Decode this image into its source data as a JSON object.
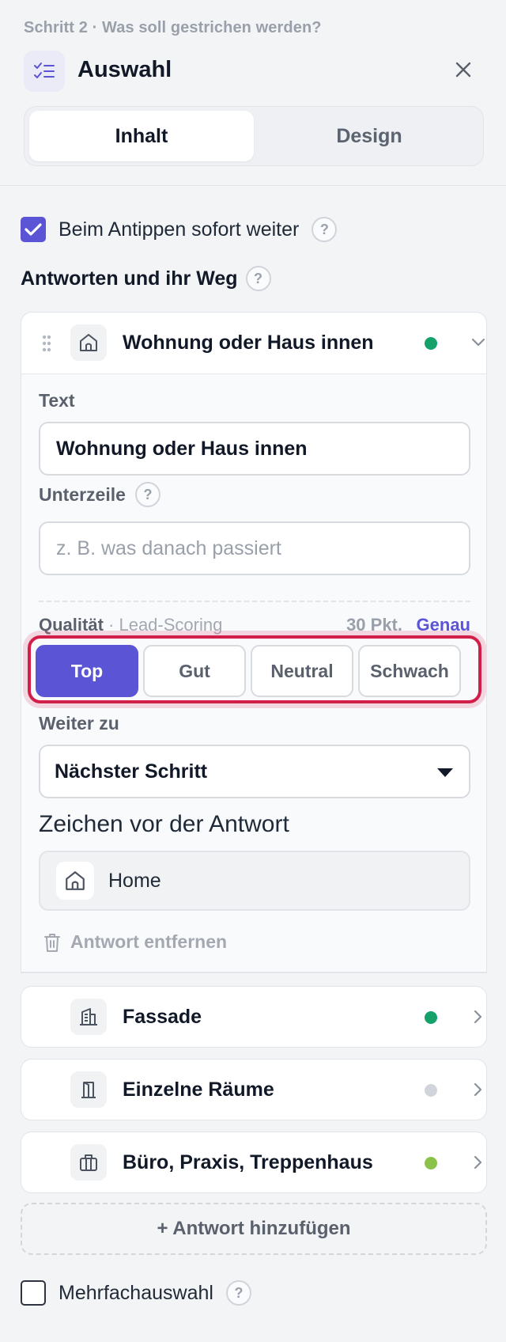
{
  "header": {
    "step": "Schritt 2 · Was soll gestrichen werden?",
    "title": "Auswahl",
    "tabs": [
      {
        "label": "Inhalt",
        "active": true
      },
      {
        "label": "Design",
        "active": false
      }
    ]
  },
  "options": {
    "auto_advance": {
      "label": "Beim Antippen sofort weiter",
      "checked": true
    },
    "answers_heading": "Antworten und ihr Weg",
    "multi_select": {
      "label": "Mehrfachauswahl",
      "checked": false
    }
  },
  "help_glyph": "?",
  "expanded_answer": {
    "title": "Wohnung oder Haus innen",
    "status_color": "#16a06a",
    "text_label": "Text",
    "text_value": "Wohnung oder Haus innen",
    "subline_label": "Unterzeile",
    "subline_placeholder": "z. B. was danach passiert",
    "quality_label": "Qualität",
    "quality_sub": "· Lead-Scoring",
    "quality_points": "30 Pkt.",
    "quality_link": "Genau",
    "quality_options": [
      "Top",
      "Gut",
      "Neutral",
      "Schwach"
    ],
    "quality_selected": "Top",
    "next_label": "Weiter zu",
    "next_value": "Nächster Schritt",
    "icon_label": "Zeichen vor der Antwort",
    "icon_value": "Home",
    "remove_label": "Antwort entfernen"
  },
  "answers": [
    {
      "title": "Fassade",
      "icon": "building-icon",
      "status_color": "#16a06a"
    },
    {
      "title": "Einzelne Räume",
      "icon": "door-icon",
      "status_color": "#d1d5db"
    },
    {
      "title": "Büro, Praxis, Treppenhaus",
      "icon": "briefcase-icon",
      "status_color": "#8bc34a"
    }
  ],
  "add_answer_label": "+ Antwort hinzufügen",
  "colors": {
    "accent": "#5b55d6",
    "highlight": "#d21f4a"
  }
}
